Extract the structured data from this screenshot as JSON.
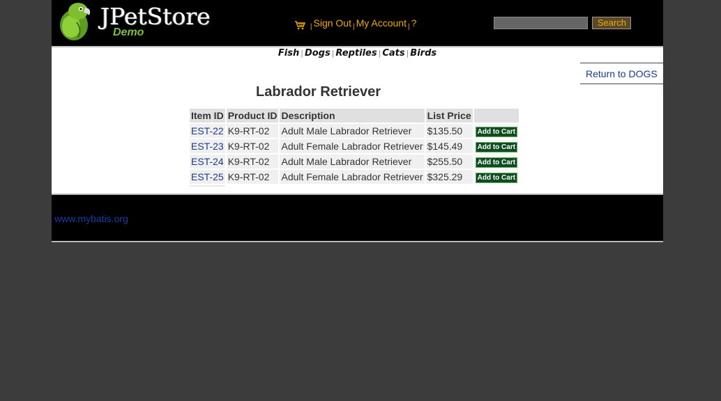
{
  "logo": {
    "title": "JPetStore",
    "subtitle": "Demo"
  },
  "menu": {
    "sign_out": "Sign Out",
    "my_account": "My Account",
    "help": "?",
    "separator": "|"
  },
  "search": {
    "value": "",
    "button": "Search"
  },
  "quicklinks": {
    "fish": "Fish",
    "dogs": "Dogs",
    "reptiles": "Reptiles",
    "cats": "Cats",
    "birds": "Birds",
    "separator": "|"
  },
  "back_link": "Return to DOGS",
  "product": {
    "title": "Labrador Retriever"
  },
  "table": {
    "headers": {
      "item_id": "Item ID",
      "product_id": "Product ID",
      "description": "Description",
      "list_price": "List Price"
    },
    "rows": [
      {
        "item_id": "EST-22",
        "product_id": "K9-RT-02",
        "description": "Adult Male Labrador Retriever",
        "price": "$135.50",
        "cart": "Add to Cart"
      },
      {
        "item_id": "EST-23",
        "product_id": "K9-RT-02",
        "description": "Adult Female Labrador Retriever",
        "price": "$145.49",
        "cart": "Add to Cart"
      },
      {
        "item_id": "EST-24",
        "product_id": "K9-RT-02",
        "description": "Adult Male Labrador Retriever",
        "price": "$255.50",
        "cart": "Add to Cart"
      },
      {
        "item_id": "EST-25",
        "product_id": "K9-RT-02",
        "description": "Adult Female Labrador Retriever",
        "price": "$325.29",
        "cart": "Add to Cart"
      }
    ]
  },
  "footer": {
    "link": "www.mybatis.org"
  },
  "colors": {
    "header_bg": "#000000",
    "menu_link": "#f2a900",
    "link": "#1a3a8a",
    "cart_button": "#0e4d1e",
    "page_bg": "#3c3c3c"
  }
}
